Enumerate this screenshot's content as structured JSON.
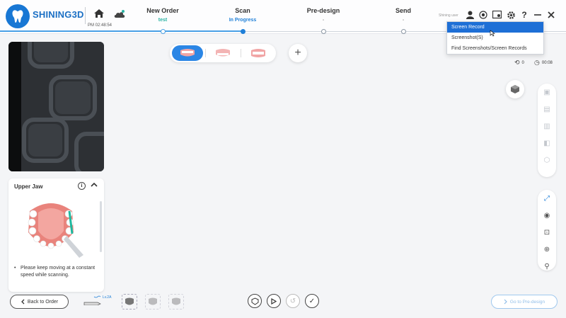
{
  "app": {
    "brand": "SHINING3D",
    "time": "PM 02:48:54",
    "user": "Shining user"
  },
  "steps": [
    {
      "name": "New Order",
      "sub": "test"
    },
    {
      "name": "Scan",
      "sub": "In Progress"
    },
    {
      "name": "Pre-design",
      "sub": "-"
    },
    {
      "name": "Send",
      "sub": "-"
    }
  ],
  "dropdown": {
    "items": [
      "Screen Record",
      "Screenshot(S)",
      "Find Screenshots/Screen Records"
    ]
  },
  "counters": {
    "count": "0",
    "timer": "00:08"
  },
  "jaw_panel": {
    "title": "Upper Jaw",
    "tip": "Please keep moving at a constant speed while scanning."
  },
  "bottom": {
    "back_label": "Back to Order",
    "pen_label": "Lv.2A",
    "next_label": "Go to Pre-design"
  },
  "colors": {
    "accent": "#1e7fd8",
    "brand": "#1877d4",
    "progress": "#49a0e6",
    "green": "#2ab3a3"
  },
  "icons": [
    "home-icon",
    "cloud-icon",
    "user-icon",
    "record-icon",
    "screenshot-icon",
    "settings-icon",
    "help-icon",
    "minimize-icon",
    "close-icon"
  ]
}
